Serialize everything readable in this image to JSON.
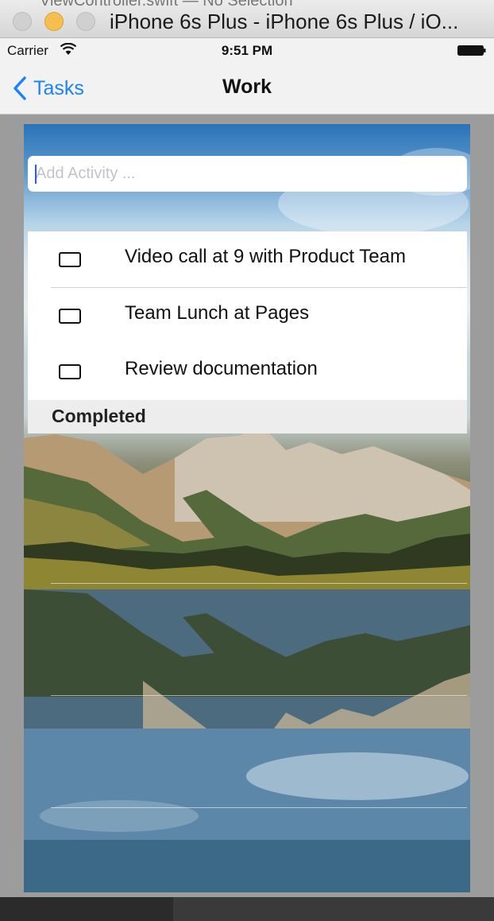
{
  "window": {
    "behind_title": "ViewController.swift — No Selection",
    "title": "iPhone 6s Plus - iPhone 6s Plus / iO..."
  },
  "status": {
    "carrier": "Carrier",
    "time": "9:51 PM",
    "icons": [
      "wifi-icon",
      "battery-icon"
    ]
  },
  "nav": {
    "back_label": "Tasks",
    "title": "Work"
  },
  "add": {
    "placeholder": "Add Activity ..."
  },
  "tasks": [
    {
      "label": "Video call at 9 with Product Team",
      "checked": false
    },
    {
      "label": "Team Lunch at Pages",
      "checked": false
    },
    {
      "label": "Review documentation",
      "checked": false
    }
  ],
  "completed": {
    "header": "Completed"
  },
  "colors": {
    "accent": "#1a82fb",
    "traffic_yellow": "#f5bf4f"
  }
}
